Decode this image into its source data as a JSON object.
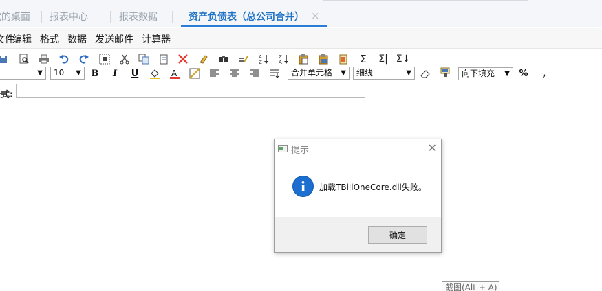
{
  "tabs": [
    {
      "label": "我的桌面"
    },
    {
      "label": "报表中心"
    },
    {
      "label": "报表数据"
    },
    {
      "label": "资产负债表（总公司合并）"
    }
  ],
  "tab_close": "×",
  "menu": [
    "文件",
    "编辑",
    "格式",
    "数据",
    "发送邮件",
    "计算器"
  ],
  "toolbar": {
    "font_size": "10",
    "merge_label": "合并单元格",
    "border_label": "细线",
    "fill_label": "向下填充",
    "percent": "%",
    "comma": ","
  },
  "formula": {
    "label": "公式:",
    "value": ""
  },
  "dialog": {
    "title": "提示",
    "message": "加载TBillOneCore.dll失败。",
    "ok_label": "确定",
    "icon": "info-icon"
  },
  "tooltip": "截图(Alt + A)",
  "colors": {
    "accent": "#2a7ed6",
    "info_icon": "#1c6fd0",
    "delete_icon": "#e23b2e"
  }
}
